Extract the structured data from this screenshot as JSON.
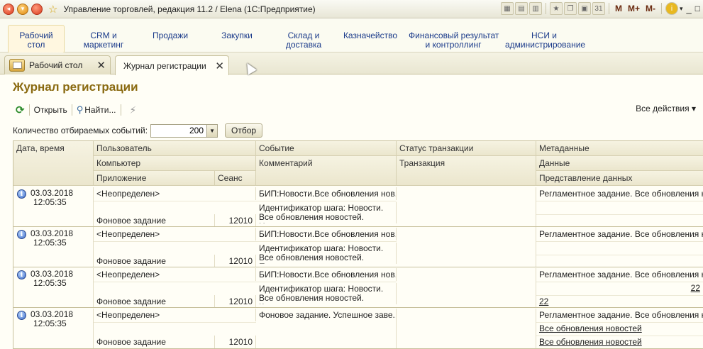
{
  "window": {
    "title": "Управление торговлей, редакция 11.2 / Elena  (1С:Предприятие)",
    "memory_buttons": [
      "M",
      "M+",
      "M-"
    ]
  },
  "sections": [
    {
      "label": "Рабочий\nстол",
      "active": true
    },
    {
      "label": "CRM и\nмаркетинг"
    },
    {
      "label": "Продажи"
    },
    {
      "label": "Закупки"
    },
    {
      "label": "Склад и\nдоставка"
    },
    {
      "label": "Казначейство"
    },
    {
      "label": "Финансовый результат\nи контроллинг"
    },
    {
      "label": "НСИ и\nадминистрирование"
    }
  ],
  "tabs": [
    {
      "label": "Рабочий стол"
    },
    {
      "label": "Журнал регистрации"
    }
  ],
  "page": {
    "title": "Журнал регистрации",
    "toolbar": {
      "open": "Открыть",
      "find": "Найти...",
      "all_actions": "Все действия ▾"
    },
    "filter": {
      "count_label": "Количество отбираемых событий:",
      "count_value": "200",
      "filter_button": "Отбор"
    }
  },
  "grid": {
    "headers": {
      "row1": [
        "Дата, время",
        "Пользователь",
        "Событие",
        "Статус транзакции",
        "Метаданные"
      ],
      "row2": [
        "Компьютер",
        "Комментарий",
        "Транзакция",
        "Данные"
      ],
      "row3": [
        "Приложение",
        "Сеанс",
        "Представление данных"
      ]
    },
    "rows": [
      {
        "date": "03.03.2018",
        "time": "12:05:35",
        "user": "<Неопределен>",
        "app": "Фоновое задание",
        "session": "12010",
        "event": "БИП:Новости.Все обновления нов...",
        "comment": "Идентификатор шага: Новости. Все обновления новостей. Начало...",
        "metadata": "Регламентное задание. Все обновления н...",
        "data": "",
        "data_repr": ""
      },
      {
        "date": "03.03.2018",
        "time": "12:05:35",
        "user": "<Неопределен>",
        "app": "Фоновое задание",
        "session": "12010",
        "event": "БИП:Новости.Все обновления нов...",
        "comment": "Идентификатор шага: Новости. Все обновления новостей. Получение и...",
        "metadata": "Регламентное задание. Все обновления н...",
        "data": "",
        "data_repr": ""
      },
      {
        "date": "03.03.2018",
        "time": "12:05:35",
        "user": "<Неопределен>",
        "app": "Фоновое задание",
        "session": "12010",
        "event": "БИП:Новости.Все обновления нов...",
        "comment": "Идентификатор шага: Новости. Все обновления новостей. Конец...",
        "metadata": "Регламентное задание. Все обновления н...",
        "data": "22",
        "data_repr": "22"
      },
      {
        "date": "03.03.2018",
        "time": "12:05:35",
        "user": "<Неопределен>",
        "app": "Фоновое задание",
        "session": "12010",
        "event": "Фоновое задание. Успешное заве...",
        "comment": "",
        "metadata": "Регламентное задание. Все обновления н...",
        "data": "Все обновления новостей",
        "data_repr": "Все обновления новостей"
      }
    ]
  }
}
